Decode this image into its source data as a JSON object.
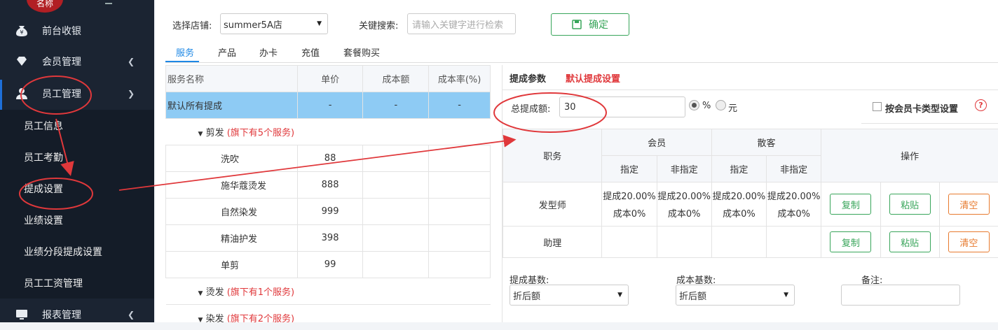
{
  "sidebar": {
    "logo_text": "名称",
    "items": [
      {
        "label": "前台收银",
        "icon": "yen-bag-icon"
      },
      {
        "label": "会员管理",
        "icon": "diamond-icon"
      },
      {
        "label": "员工管理",
        "icon": "user-icon"
      },
      {
        "label": "报表管理",
        "icon": "monitor-icon"
      }
    ],
    "sub_items": [
      "员工信息",
      "员工考勤",
      "提成设置",
      "业绩设置",
      "业绩分段提成设置",
      "员工工资管理"
    ]
  },
  "filters": {
    "store_label": "选择店铺:",
    "store_value": "summer5A店",
    "search_label": "关键搜索:",
    "search_placeholder": "请输入关键字进行检索",
    "confirm_label": "确定"
  },
  "tabs": [
    "服务",
    "产品",
    "办卡",
    "充值",
    "套餐购买"
  ],
  "left_table": {
    "headers": [
      "服务名称",
      "单价",
      "成本额",
      "成本率(%)"
    ],
    "default_row": {
      "name": "默认所有提成",
      "price": "-",
      "cost": "-",
      "rate": "-"
    },
    "groups": [
      {
        "name": "剪发",
        "note": "(旗下有5个服务)"
      },
      {
        "name": "烫发",
        "note": "(旗下有1个服务)"
      },
      {
        "name": "染发",
        "note": "(旗下有2个服务)"
      }
    ],
    "rows": [
      {
        "name": "洗吹",
        "price": "88"
      },
      {
        "name": "施华蔻烫发",
        "price": "888"
      },
      {
        "name": "自然染发",
        "price": "999"
      },
      {
        "name": "精油护发",
        "price": "398"
      },
      {
        "name": "单剪",
        "price": "99"
      }
    ]
  },
  "right": {
    "title": "提成参数",
    "subtitle": "默认提成设置",
    "total_label": "总提成额:",
    "total_value": "30",
    "unit_percent": "%",
    "unit_yuan": "元",
    "card_type_label": "按会员卡类型设置",
    "help_icon": "?",
    "table": {
      "col_role": "职务",
      "col_member": "会员",
      "col_guest": "散客",
      "col_ops": "操作",
      "sub_assigned": "指定",
      "sub_unassigned": "非指定",
      "rows": [
        {
          "role": "发型师",
          "cells": [
            {
              "line1": "提成20.00%",
              "line2": "成本0%"
            },
            {
              "line1": "提成20.00%",
              "line2": "成本0%"
            },
            {
              "line1": "提成20.00%",
              "line2": "成本0%"
            },
            {
              "line1": "提成20.00%",
              "line2": "成本0%"
            }
          ]
        },
        {
          "role": "助理"
        }
      ],
      "btn_copy": "复制",
      "btn_paste": "粘贴",
      "btn_clear": "清空"
    },
    "base_label": "提成基数:",
    "base_value": "折后额",
    "cost_base_label": "成本基数:",
    "cost_base_value": "折后额",
    "remark_label": "备注:"
  },
  "colors": {
    "sidebar": "#1b2432",
    "highlight_row": "#8ecbf4",
    "accent": "#1e88e5",
    "annotation": "#e0383b"
  }
}
